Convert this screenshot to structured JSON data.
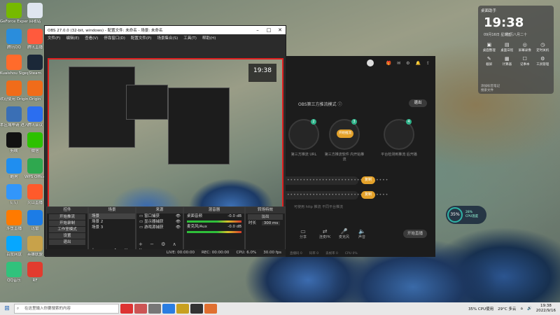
{
  "desktop_icons": [
    {
      "label": "GeForce Experience",
      "color": "#76b900"
    },
    {
      "label": "回收站",
      "color": "#dfe6ef"
    },
    {
      "label": "腾讯QQ",
      "color": "#2a8ddc"
    },
    {
      "label": "腾讯直播",
      "color": "#ff5a3d"
    },
    {
      "label": "Kuaishou Sigepa 2020",
      "color": "#ff6b2b"
    },
    {
      "label": "Steam",
      "color": "#1b2838"
    },
    {
      "label": "欢迎使用 Origin",
      "color": "#f06c1a"
    },
    {
      "label": "Origin",
      "color": "#f06c1a"
    },
    {
      "label": "本区域申请 进入工作",
      "color": "#3a6fb5"
    },
    {
      "label": "腾讯会议",
      "color": "#2b6ef0"
    },
    {
      "label": "剪映",
      "color": "#111"
    },
    {
      "label": "微信",
      "color": "#2dc100"
    },
    {
      "label": "酷狗",
      "color": "#1f8ef0"
    },
    {
      "label": "WPS Office",
      "color": "#2fa84f"
    },
    {
      "label": "钉钉",
      "color": "#3296fa"
    },
    {
      "label": "火山直播",
      "color": "#ff5a2b"
    },
    {
      "label": "斗鱼直播",
      "color": "#ff7a00"
    },
    {
      "label": "迅雷",
      "color": "#1c7ce6"
    },
    {
      "label": "百度网盘",
      "color": "#06a7ff"
    },
    {
      "label": "英雄联盟",
      "color": "#c8a24a"
    },
    {
      "label": "QQ音乐",
      "color": "#31c27c"
    },
    {
      "label": "RF",
      "color": "#e23b2e"
    }
  ],
  "obs": {
    "title": "OBS 27.0.0 (32-bit, windows) - 配置文件: 未命名 - 场景: 未命名",
    "menu": [
      "文件(F)",
      "编辑(E)",
      "查看(V)",
      "停靠窗口(D)",
      "配置文件(P)",
      "场景集合(S)",
      "工具(T)",
      "帮助(H)"
    ],
    "docks": {
      "controls": {
        "title": "控件",
        "buttons": [
          "开始推流",
          "开始录制",
          "工作室模式",
          "设置",
          "退出"
        ]
      },
      "scenes": {
        "title": "场景",
        "items": [
          "场景",
          "场景 2",
          "场景 3"
        ]
      },
      "sources": {
        "title": "来源",
        "items": [
          "窗口捕获",
          "显示器捕获",
          "游戏源捕获"
        ]
      },
      "mixer": {
        "title": "混音器",
        "channels": [
          {
            "name": "桌面音频",
            "db": "-0.0 dB"
          },
          {
            "name": "麦克风/Aux",
            "db": "-0.0 dB"
          }
        ]
      },
      "transitions": {
        "title": "转场特效",
        "type": "淡出",
        "duration_label": "时长",
        "duration": "300 ms"
      }
    },
    "status": {
      "live": "LIVE: 00:00:00",
      "rec": "REC: 00:00:00",
      "cpu": "CPU: 6.0%",
      "fps": "30.00 fps"
    }
  },
  "stream_app": {
    "mode_label": "OBS第三方推流模式",
    "exit_label": "退出",
    "steps": [
      {
        "num": "2",
        "inner": "",
        "label": "第三方推流 URL"
      },
      {
        "num": "3",
        "inner": "开始推流",
        "label": "第三方推流软件 内开始推流"
      },
      {
        "num": "4",
        "inner": "",
        "label": "平台检测到推流 后开播"
      }
    ],
    "server_mask": "••••••••••••••••••••••••••••••••",
    "key_mask": "••••••••••••••••••••••••••••••••",
    "copy_label": "复制",
    "note": "可使用 http 推流 不同平台推流",
    "tools": [
      "分享",
      "连麦PK",
      "麦克风",
      "声音"
    ],
    "live_button": "开始直播",
    "status_items": [
      "直播码 0",
      "码率 0",
      "丢帧率 0",
      "CPU 0%"
    ]
  },
  "clock_widget": {
    "title": "桌面助手",
    "time": "19:38",
    "date": "09月16日 星期五",
    "extra": "农历八月二十",
    "grid": [
      {
        "icon": "▣",
        "label": "桌面整理"
      },
      {
        "icon": "▤",
        "label": "桌面日程"
      },
      {
        "icon": "◎",
        "label": "屏幕录像"
      },
      {
        "icon": "◷",
        "label": "定时关机"
      },
      {
        "icon": "✎",
        "label": "截屏"
      },
      {
        "icon": "▦",
        "label": "计算器"
      },
      {
        "icon": "☐",
        "label": "记事本"
      },
      {
        "icon": "⚙",
        "label": "工具管理"
      }
    ],
    "list": [
      "添加标签笔记",
      "搜索文件"
    ]
  },
  "gauge": {
    "percent": "35%",
    "line1": "28%",
    "line2": "CPU温度"
  },
  "taskbar": {
    "search_placeholder": "在这里输入你要搜索的内容",
    "weather": "29°C 多云",
    "cpu": "35% CPU使用",
    "time": "19:38",
    "date": "2022/9/16"
  }
}
